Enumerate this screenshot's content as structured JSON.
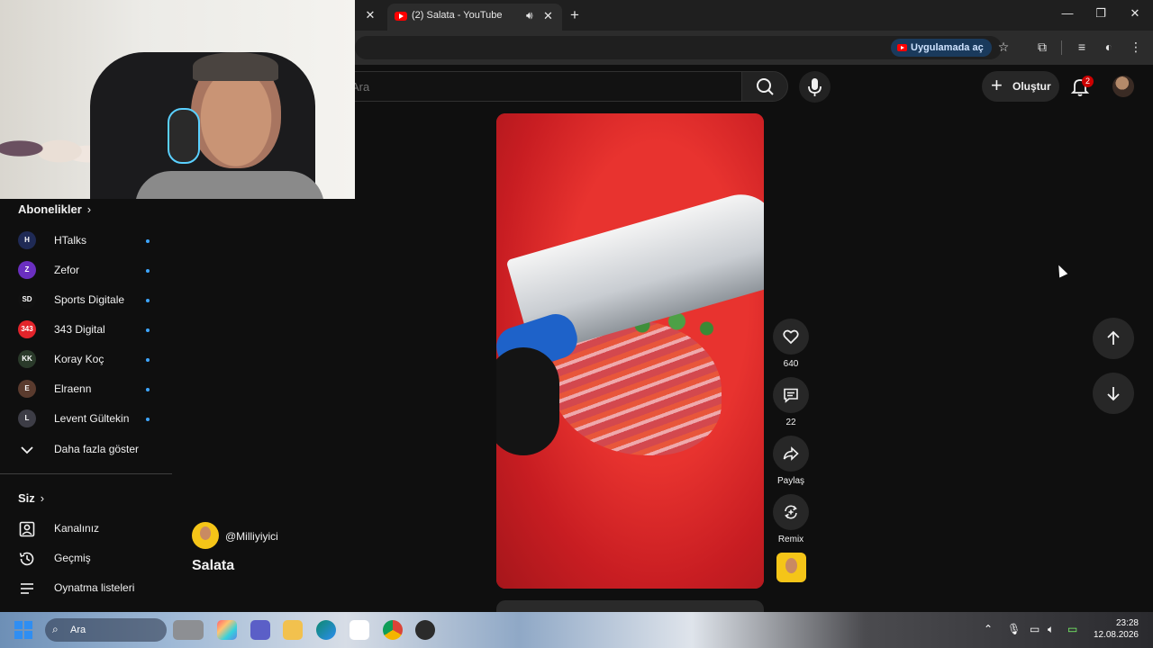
{
  "browser": {
    "tab_title": "(2) Salata - YouTube",
    "open_in_app_label": "Uygulamada aç"
  },
  "youtube": {
    "search_placeholder": "Ara",
    "create_label": "Oluştur",
    "notification_count": "2"
  },
  "sidebar": {
    "subscriptions_title": "Abonelikler",
    "subscriptions": [
      {
        "name": "HTalks",
        "avatar_text": "H",
        "color": "#1f2a55"
      },
      {
        "name": "Zefor",
        "avatar_text": "Z",
        "color": "#6a2fc0"
      },
      {
        "name": "Sports Digitale",
        "avatar_text": "SD",
        "color": "#111111"
      },
      {
        "name": "343 Digital",
        "avatar_text": "343",
        "color": "#e3242b"
      },
      {
        "name": "Koray Koç",
        "avatar_text": "KK",
        "color": "#2a3a2a"
      },
      {
        "name": "Elraenn",
        "avatar_text": "E",
        "color": "#5a3b2e"
      },
      {
        "name": "Levent Gültekin",
        "avatar_text": "L",
        "color": "#3d3d46"
      }
    ],
    "show_more_label": "Daha fazla göster",
    "you_title": "Siz",
    "you_items": [
      {
        "label": "Kanalınız",
        "icon": "channel-icon"
      },
      {
        "label": "Geçmiş",
        "icon": "history-icon"
      },
      {
        "label": "Oynatma listeleri",
        "icon": "playlists-icon"
      }
    ]
  },
  "short": {
    "channel_handle": "@Milliyiyici",
    "title": "Salata",
    "like_count": "640",
    "comment_count": "22",
    "share_label": "Paylaş",
    "remix_label": "Remix"
  },
  "taskbar": {
    "search_placeholder": "Ara",
    "time": "23:28",
    "date": "12.08.2026"
  },
  "colors": {
    "background": "#0f0f0f",
    "accent_red": "#ff0000",
    "subscription_dot": "#3ea6ff"
  }
}
